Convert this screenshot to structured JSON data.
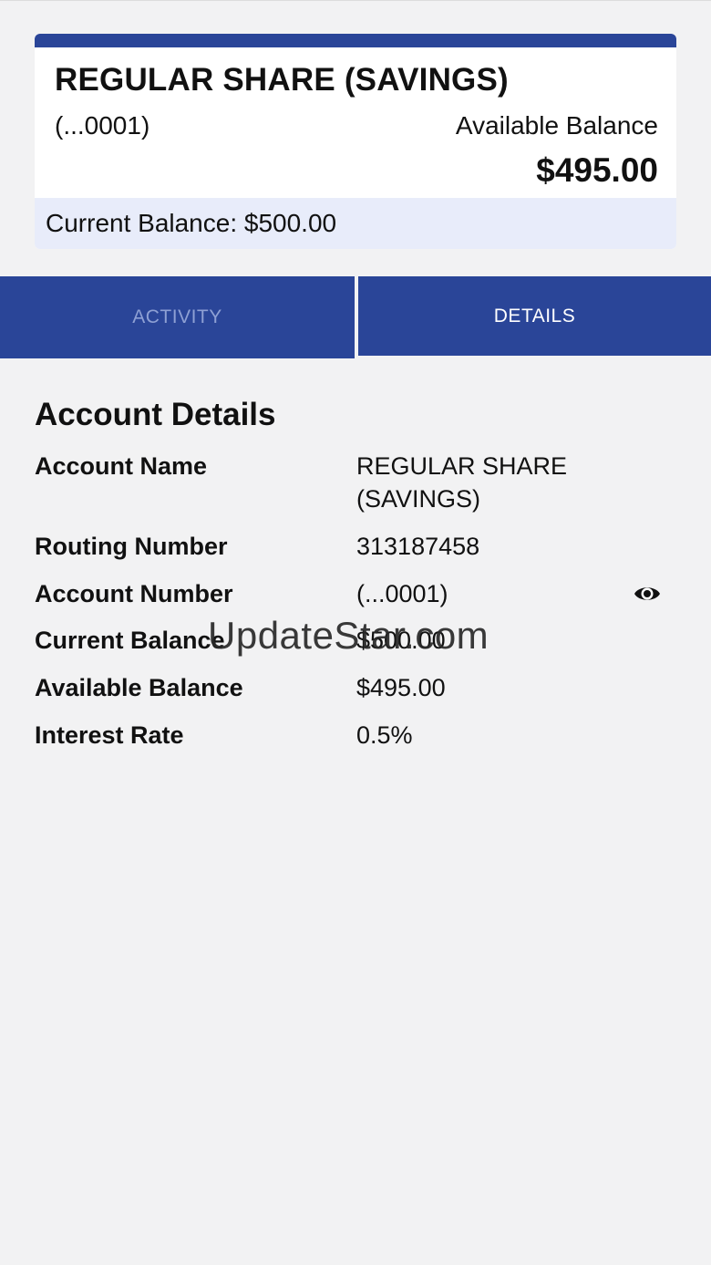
{
  "account_card": {
    "title": "REGULAR SHARE (SAVINGS)",
    "masked_number": "(...0001)",
    "available_label": "Available Balance",
    "available_value": "$495.00",
    "current_balance_text": "Current Balance: $500.00",
    "accent_color": "#2a4598"
  },
  "tabs": [
    {
      "label": "ACTIVITY",
      "active": false
    },
    {
      "label": "DETAILS",
      "active": true
    }
  ],
  "details": {
    "title": "Account Details",
    "rows": [
      {
        "label": "Account Name",
        "value": "REGULAR SHARE (SAVINGS)"
      },
      {
        "label": "Routing Number",
        "value": "313187458"
      },
      {
        "label": "Account Number",
        "value": "(...0001)",
        "icon": "eye-icon"
      },
      {
        "label": "Current Balance",
        "value": "$500.00"
      },
      {
        "label": "Available Balance",
        "value": "$495.00"
      },
      {
        "label": "Interest Rate",
        "value": "0.5%"
      }
    ]
  },
  "watermark": "UpdateStar.com"
}
